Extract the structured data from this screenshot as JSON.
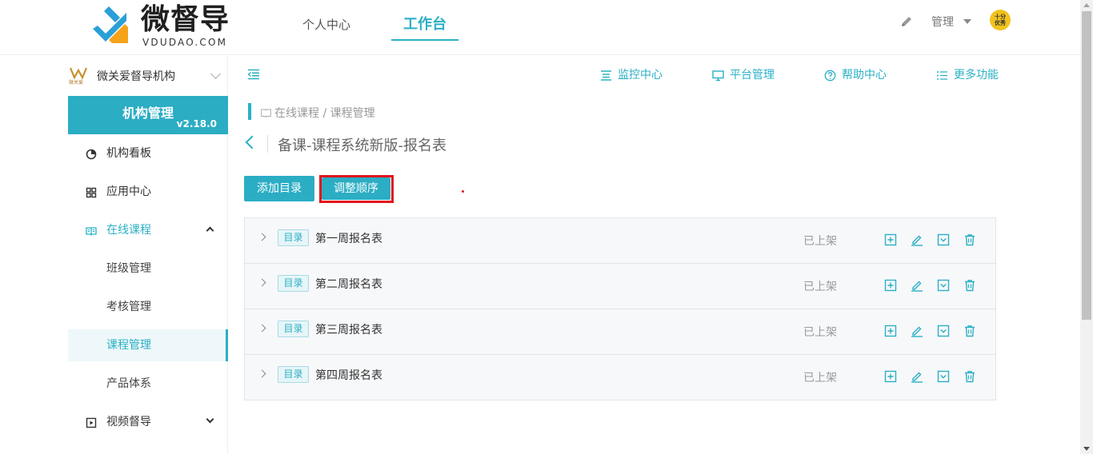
{
  "brand": {
    "title": "微督导",
    "subtitle": "VDUDAO.COM"
  },
  "topnav": {
    "personal": "个人中心",
    "workbench": "工作台"
  },
  "user": {
    "name": "管理",
    "avatar_text_1": "十分",
    "avatar_text_2": "优秀"
  },
  "colors": {
    "accent": "#2bb0c5",
    "highlight": "#e0141c"
  },
  "sidebar": {
    "org_name": "微关爱督导机构",
    "org_logo_caption": "微关爱",
    "section_title": "机构管理",
    "version": "v2.18.0",
    "items": [
      {
        "label": "机构看板",
        "icon": "pie-chart-icon"
      },
      {
        "label": "应用中心",
        "icon": "grid-icon"
      },
      {
        "label": "在线课程",
        "icon": "book-icon"
      },
      {
        "label": "班级管理"
      },
      {
        "label": "考核管理"
      },
      {
        "label": "课程管理"
      },
      {
        "label": "产品体系"
      },
      {
        "label": "视频督导",
        "icon": "video-icon"
      }
    ]
  },
  "toolbar": {
    "monitor": "监控中心",
    "platform": "平台管理",
    "help": "帮助中心",
    "more": "更多功能"
  },
  "breadcrumb": "在线课程 / 课程管理",
  "page_title": "备课-课程系统新版-报名表",
  "actions": {
    "add": "添加目录",
    "reorder": "调整顺序"
  },
  "rows": [
    {
      "tag": "目录",
      "name": "第一周报名表",
      "status": "已上架"
    },
    {
      "tag": "目录",
      "name": "第二周报名表",
      "status": "已上架"
    },
    {
      "tag": "目录",
      "name": "第三周报名表",
      "status": "已上架"
    },
    {
      "tag": "目录",
      "name": "第四周报名表",
      "status": "已上架"
    }
  ]
}
